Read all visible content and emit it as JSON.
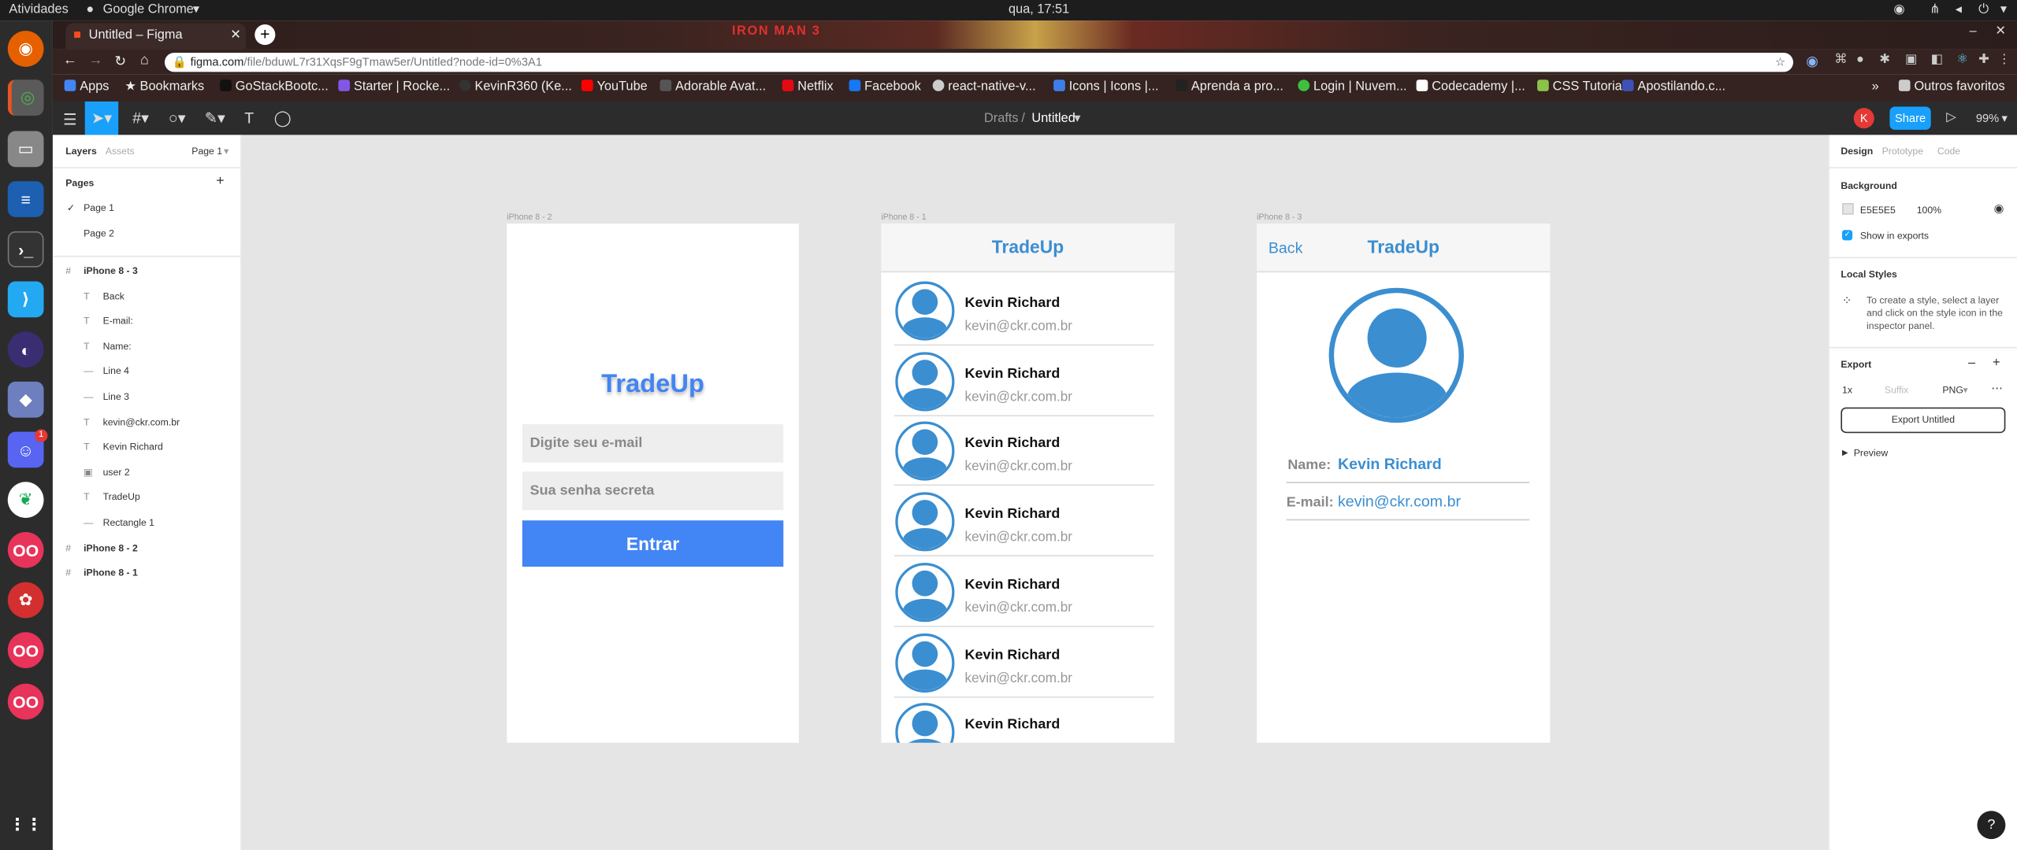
{
  "system": {
    "activities": "Atividades",
    "app": "Google Chrome",
    "clock": "qua, 17:51",
    "discord_badge": "1"
  },
  "browser": {
    "tab_title": "Untitled – Figma",
    "url_host": "figma.com",
    "url_path": "/file/bduwL7r31XqsF9gTmaw5er/Untitled?node-id=0%3A1",
    "bookmarks": [
      "Apps",
      "Bookmarks",
      "GoStackBootc...",
      "Starter | Rocke...",
      "KevinR360 (Ke...",
      "YouTube",
      "Adorable Avat...",
      "Netflix",
      "Facebook",
      "react-native-v...",
      "Icons | Icons |...",
      "Aprenda a pro...",
      "Login | Nuvem...",
      "Codecademy |...",
      "CSS Tutorial",
      "Apostilando.c..."
    ],
    "other_bookmarks": "Outros favoritos"
  },
  "figma": {
    "breadcrumb_root": "Drafts",
    "breadcrumb_sep": "/",
    "file_name": "Untitled",
    "avatar_letter": "K",
    "share": "Share",
    "zoom": "99%",
    "left": {
      "tab_layers": "Layers",
      "tab_assets": "Assets",
      "page_select": "Page 1",
      "pages_title": "Pages",
      "add": "+",
      "pages": [
        "Page 1",
        "Page 2"
      ],
      "layers": [
        {
          "name": "iPhone 8 - 3",
          "kind": "frame",
          "indent": 0
        },
        {
          "name": "Back",
          "kind": "text",
          "indent": 1
        },
        {
          "name": "E-mail:",
          "kind": "text",
          "indent": 1
        },
        {
          "name": "Name:",
          "kind": "text",
          "indent": 1
        },
        {
          "name": "Line 4",
          "kind": "line",
          "indent": 1
        },
        {
          "name": "Line 3",
          "kind": "line",
          "indent": 1
        },
        {
          "name": "kevin@ckr.com.br",
          "kind": "text",
          "indent": 1
        },
        {
          "name": "Kevin Richard",
          "kind": "text",
          "indent": 1
        },
        {
          "name": "user 2",
          "kind": "image",
          "indent": 1
        },
        {
          "name": "TradeUp",
          "kind": "text",
          "indent": 1
        },
        {
          "name": "Rectangle 1",
          "kind": "line",
          "indent": 1
        },
        {
          "name": "iPhone 8 - 2",
          "kind": "frame",
          "indent": 0
        },
        {
          "name": "iPhone 8 - 1",
          "kind": "frame",
          "indent": 0
        }
      ]
    },
    "right": {
      "tab_design": "Design",
      "tab_prototype": "Prototype",
      "tab_code": "Code",
      "bg_title": "Background",
      "bg_hex": "E5E5E5",
      "bg_opacity": "100%",
      "show_exports": "Show in exports",
      "local_styles": "Local Styles",
      "local_styles_hint": "To create a style, select a layer and click on the style icon in the inspector panel.",
      "export_title": "Export",
      "export_scale": "1x",
      "export_suffix": "Suffix",
      "export_format": "PNG",
      "export_button": "Export Untitled",
      "preview": "Preview"
    },
    "frames": {
      "login": {
        "label": "iPhone 8 - 2",
        "title": "TradeUp",
        "email_placeholder": "Digite seu e-mail",
        "password_placeholder": "Sua senha secreta",
        "button": "Entrar"
      },
      "list": {
        "label": "iPhone 8 - 1",
        "title": "TradeUp",
        "items": [
          {
            "name": "Kevin Richard",
            "email": "kevin@ckr.com.br"
          },
          {
            "name": "Kevin Richard",
            "email": "kevin@ckr.com.br"
          },
          {
            "name": "Kevin Richard",
            "email": "kevin@ckr.com.br"
          },
          {
            "name": "Kevin Richard",
            "email": "kevin@ckr.com.br"
          },
          {
            "name": "Kevin Richard",
            "email": "kevin@ckr.com.br"
          },
          {
            "name": "Kevin Richard",
            "email": "kevin@ckr.com.br"
          },
          {
            "name": "Kevin Richard",
            "email": ""
          }
        ]
      },
      "detail": {
        "label": "iPhone 8 - 3",
        "back": "Back",
        "title": "TradeUp",
        "name_label": "Name:",
        "name_value": "Kevin Richard",
        "email_label": "E-mail:",
        "email_value": "kevin@ckr.com.br"
      }
    },
    "help": "?"
  },
  "colors": {
    "accent": "#3b8ed0",
    "brand_blue": "#4285f4",
    "figma_blue": "#18a0fb"
  }
}
